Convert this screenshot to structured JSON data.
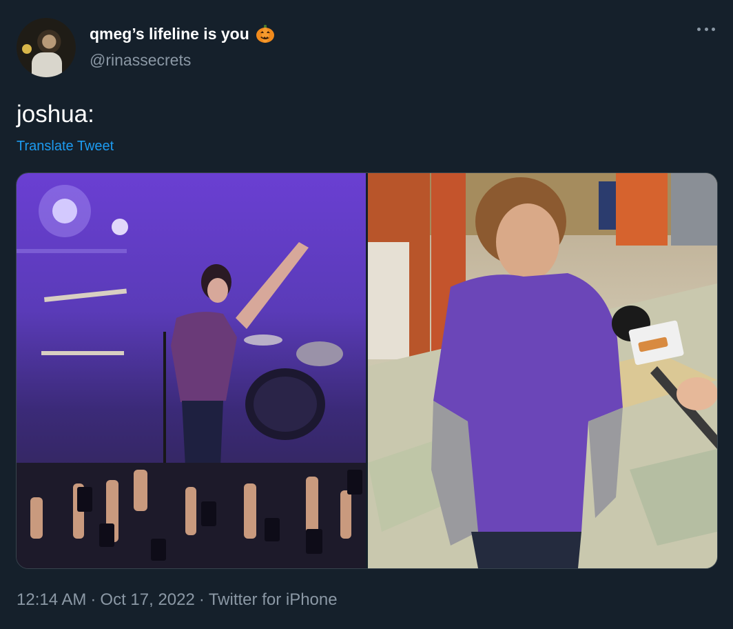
{
  "author": {
    "display_name": "qmeg’s lifeline is you",
    "handle": "@rinassecrets",
    "name_emoji": "pumpkin-emoji"
  },
  "tweet": {
    "text": "joshua:",
    "translate_label": "Translate Tweet"
  },
  "media": {
    "count": 2,
    "items": [
      {
        "subject": "concert-photo"
      },
      {
        "subject": "interview-photo"
      }
    ]
  },
  "footer": {
    "time": "12:14 AM",
    "separator": "·",
    "date": "Oct 17, 2022",
    "client": "Twitter for iPhone"
  },
  "colors": {
    "background": "#15202b",
    "secondary_text": "#8b98a5",
    "link": "#1d9bf0",
    "border": "#38444d"
  }
}
